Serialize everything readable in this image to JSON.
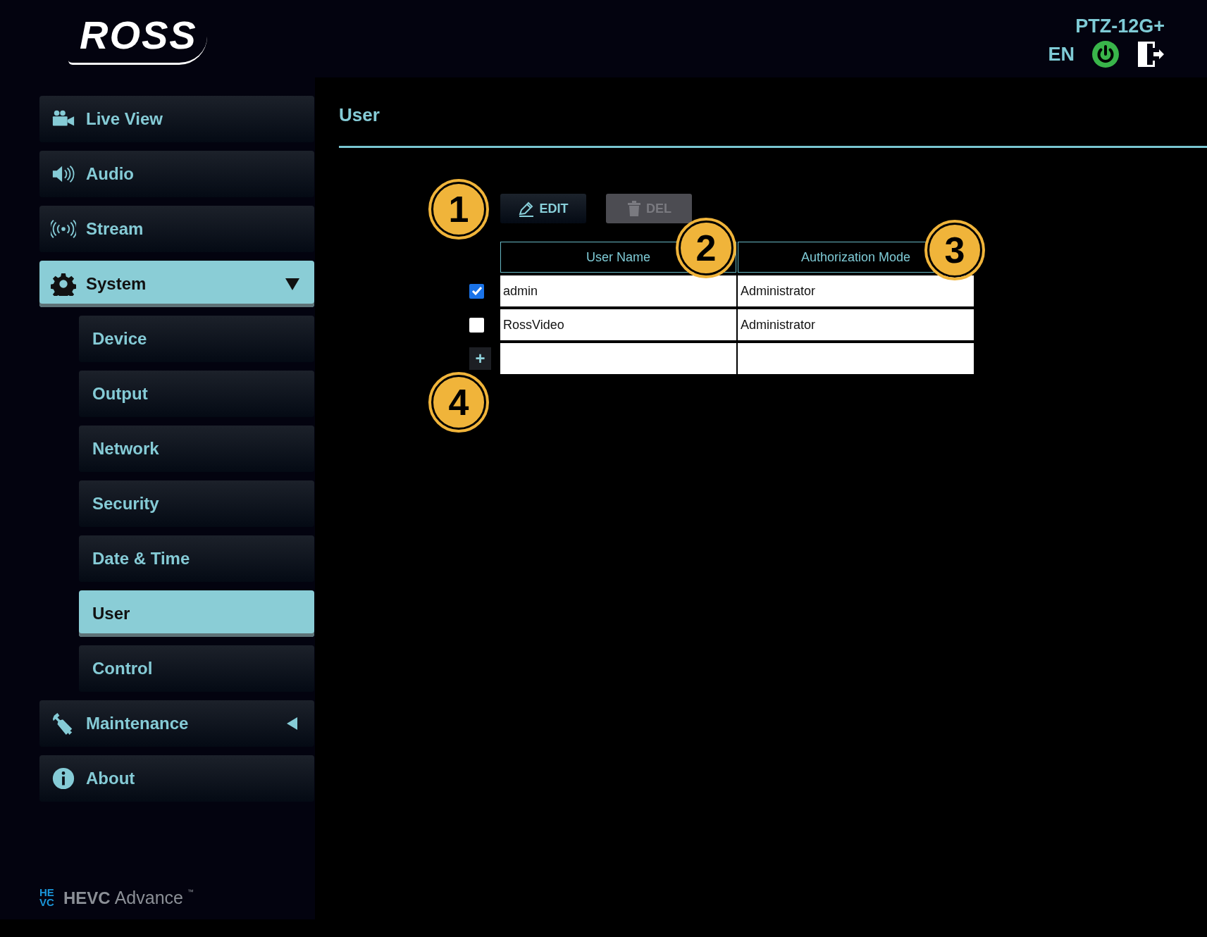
{
  "header": {
    "logo": "ROSS",
    "model": "PTZ-12G+",
    "language": "EN"
  },
  "sidebar": {
    "items": [
      {
        "label": "Live View",
        "kind": "main",
        "selected": false
      },
      {
        "label": "Audio",
        "kind": "main",
        "selected": false
      },
      {
        "label": "Stream",
        "kind": "main",
        "selected": false
      },
      {
        "label": "System",
        "kind": "main",
        "selected": true,
        "expanded": true,
        "children": [
          {
            "label": "Device",
            "kind": "sub",
            "selected": false
          },
          {
            "label": "Output",
            "kind": "sub",
            "selected": false
          },
          {
            "label": "Network",
            "kind": "sub",
            "selected": false
          },
          {
            "label": "Security",
            "kind": "sub",
            "selected": false
          },
          {
            "label": "Date & Time",
            "kind": "sub",
            "selected": false
          },
          {
            "label": "User",
            "kind": "sub",
            "selected": true
          },
          {
            "label": "Control",
            "kind": "sub",
            "selected": false
          }
        ]
      },
      {
        "label": "Maintenance",
        "kind": "main",
        "selected": false,
        "expanded": false
      },
      {
        "label": "About",
        "kind": "main",
        "selected": false
      }
    ],
    "footer_logo": {
      "mark": "HEVC",
      "name": "HEVC",
      "word": "Advance",
      "tm": "™"
    }
  },
  "page": {
    "title": "User"
  },
  "toolbar": {
    "buttons": [
      {
        "label": "EDIT",
        "kind": "edit",
        "disabled": false
      },
      {
        "label": "DEL",
        "kind": "delete",
        "disabled": true
      }
    ]
  },
  "table": {
    "columns": [
      "User Name",
      "Authorization Mode"
    ],
    "rows": [
      {
        "cells": [
          "admin",
          "Administrator"
        ],
        "checked": true
      },
      {
        "cells": [
          "RossVideo",
          "Administrator"
        ],
        "checked": false
      }
    ],
    "add_row": {
      "label": "+"
    }
  },
  "callouts": [
    "1",
    "2",
    "3",
    "4"
  ]
}
